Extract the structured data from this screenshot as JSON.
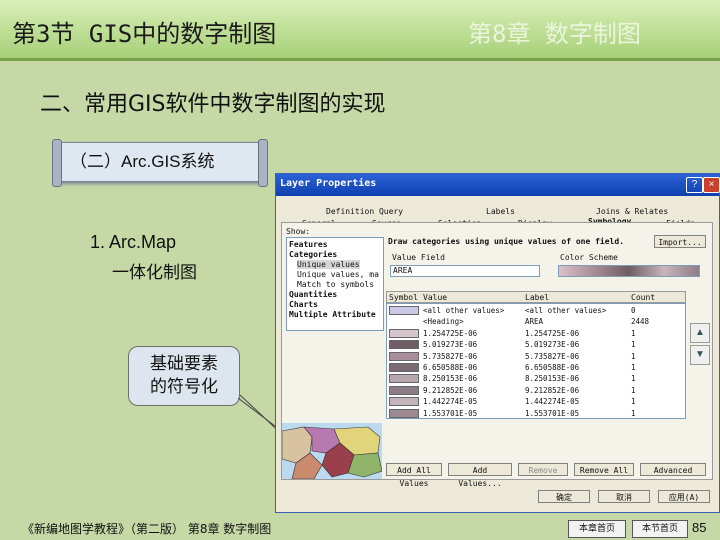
{
  "header": {
    "section_title": "第3节 GIS中的数字制图",
    "chapter_title": "第8章 数字制图"
  },
  "subtitle": "二、常用GIS软件中数字制图的实现",
  "banner": "（二）Arc.GIS系统",
  "item": {
    "number_label": "1. Arc.Map",
    "desc": "一体化制图"
  },
  "callout": {
    "line1": "基础要素",
    "line2": "的符号化"
  },
  "window": {
    "title": "Layer Properties",
    "help": "?",
    "close": "×",
    "tabs_row1": [
      "Definition Query",
      "Labels",
      "Joins & Relates"
    ],
    "tabs_row2": [
      "General",
      "Source",
      "Selection",
      "Display",
      "Symbology",
      "Fields"
    ],
    "show_label": "Show:",
    "tree": [
      "Features",
      "Categories",
      "Unique values",
      "Unique values, ma",
      "Match to symbols",
      "Quantities",
      "Charts",
      "Multiple Attribute"
    ],
    "draw_text": "Draw categories using unique values of one field.",
    "import": "Import...",
    "value_field_label": "Value Field",
    "value_field": "AREA",
    "color_scheme_label": "Color Scheme",
    "table_headers": [
      "Symbol",
      "Value",
      "Label",
      "Count"
    ],
    "rows": [
      {
        "value": "<all other values>",
        "label": "<all other values>",
        "count": "0",
        "color": "#c9c9e6"
      },
      {
        "value": "<Heading>",
        "label": "AREA",
        "count": "2448",
        "color": ""
      },
      {
        "value": "1.254725E-06",
        "label": "1.254725E-06",
        "count": "1",
        "color": "#d5c6cb"
      },
      {
        "value": "5.019273E-06",
        "label": "5.019273E-06",
        "count": "1",
        "color": "#6e5e63"
      },
      {
        "value": "5.735827E-06",
        "label": "5.735827E-06",
        "count": "1",
        "color": "#a98f99"
      },
      {
        "value": "6.650588E-06",
        "label": "6.650588E-06",
        "count": "1",
        "color": "#7b6a72"
      },
      {
        "value": "8.250153E-06",
        "label": "8.250153E-06",
        "count": "1",
        "color": "#b7a7ae"
      },
      {
        "value": "9.212852E-06",
        "label": "9.212852E-06",
        "count": "1",
        "color": "#8d7d86"
      },
      {
        "value": "1.442274E-05",
        "label": "1.442274E-05",
        "count": "1",
        "color": "#c3b4b9"
      },
      {
        "value": "1.553701E-05",
        "label": "1.553701E-05",
        "count": "1",
        "color": "#9e8a92"
      }
    ],
    "buttons": [
      "Add All Values",
      "Add Values...",
      "Remove",
      "Remove All",
      "Advanced"
    ],
    "ok": "确定",
    "cancel": "取消",
    "apply": "应用(A)"
  },
  "footer": {
    "book": "《新编地图学教程》（第二版） 第8章 数字制图",
    "chapter_home": "本章首页",
    "section_home": "本节首页",
    "page": "85"
  }
}
